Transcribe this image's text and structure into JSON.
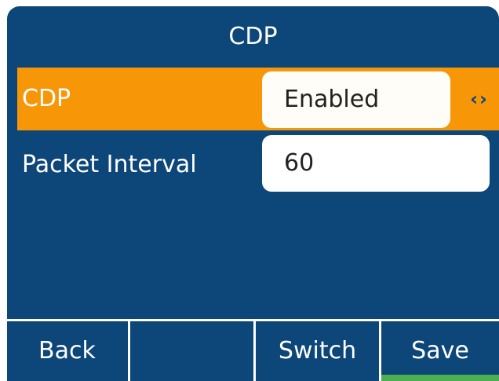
{
  "screen": {
    "title": "CDP"
  },
  "rows": [
    {
      "label": "CDP",
      "value": "Enabled",
      "selector": "‹›"
    },
    {
      "label": "Packet Interval",
      "value": "60"
    }
  ],
  "softkeys": {
    "back": "Back",
    "empty": "",
    "switch": "Switch",
    "save": "Save"
  },
  "colors": {
    "background": "#0d4678",
    "highlight": "#f79708",
    "save_indicator": "#4caf50"
  }
}
